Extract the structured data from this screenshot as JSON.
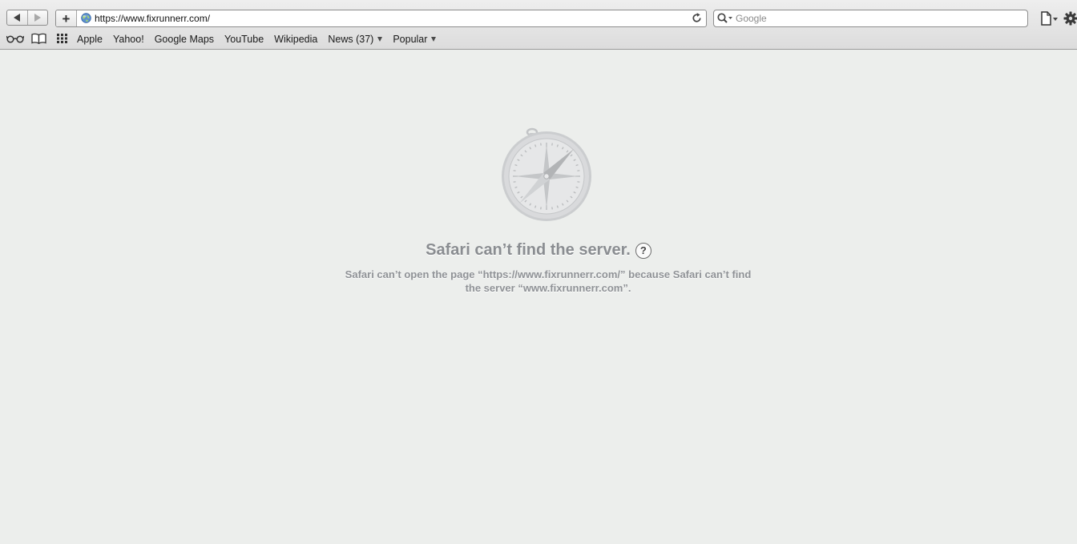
{
  "toolbar": {
    "url": "https://www.fixrunnerr.com/",
    "add_label": "+",
    "search_placeholder": "Google",
    "search_value": ""
  },
  "bookmarks": {
    "items": [
      {
        "label": "Apple"
      },
      {
        "label": "Yahoo!"
      },
      {
        "label": "Google Maps"
      },
      {
        "label": "YouTube"
      },
      {
        "label": "Wikipedia"
      },
      {
        "label": "News (37)",
        "has_menu": true
      },
      {
        "label": "Popular",
        "has_menu": true
      }
    ]
  },
  "error": {
    "title": "Safari can’t find the server.",
    "help": "?",
    "message": "Safari can’t open the page “https://www.fixrunnerr.com/” because Safari can’t find the server “www.fixrunnerr.com”."
  },
  "icons": {
    "back": "back-arrow-icon",
    "forward": "forward-arrow-icon",
    "site": "globe-icon",
    "reload": "reload-icon",
    "search": "magnifier-icon",
    "reading_list": "glasses-icon",
    "bookmarks": "open-book-icon",
    "top_sites": "grid-icon",
    "page_menu": "page-icon",
    "settings": "gear-icon",
    "error": "compass-icon"
  },
  "colors": {
    "content_background": "#eceeec",
    "error_text": "#8a8d91",
    "toolbar": "#dcdcdc"
  }
}
